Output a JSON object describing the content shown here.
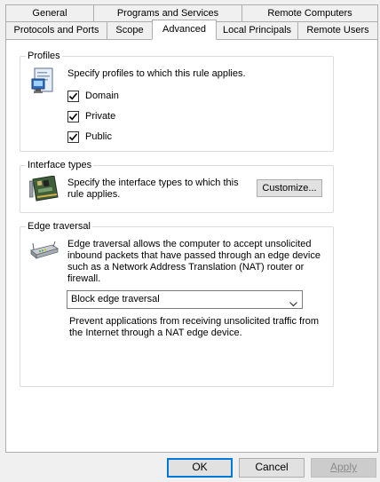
{
  "tabs": {
    "row1": [
      "General",
      "Programs and Services",
      "Remote Computers"
    ],
    "row2": [
      "Protocols and Ports",
      "Scope",
      "Advanced",
      "Local Principals",
      "Remote Users"
    ],
    "active": "Advanced"
  },
  "profiles": {
    "legend": "Profiles",
    "description": "Specify profiles to which this rule applies.",
    "items": [
      {
        "label": "Domain",
        "checked": true
      },
      {
        "label": "Private",
        "checked": true
      },
      {
        "label": "Public",
        "checked": true
      }
    ]
  },
  "interface_types": {
    "legend": "Interface types",
    "description_line1": "Specify the interface types to which this",
    "description_line2": "rule applies.",
    "customize_label": "Customize..."
  },
  "edge_traversal": {
    "legend": "Edge traversal",
    "description_lines": [
      "Edge traversal allows the computer to accept unsolicited",
      "inbound packets that have passed through an edge device",
      "such as a Network Address Translation (NAT) router or",
      "firewall."
    ],
    "selected_option": "Block edge traversal",
    "option_description_lines": [
      "Prevent applications from receiving unsolicited traffic from",
      "the Internet through a NAT edge device."
    ]
  },
  "footer": {
    "ok_label": "OK",
    "cancel_label": "Cancel",
    "apply_label": "Apply"
  },
  "icons": {
    "profiles": "computer-profile-icon",
    "interface": "network-card-icon",
    "edge": "router-icon",
    "checkbox": "checkmark-icon",
    "select": "chevron-down-icon"
  },
  "colors": {
    "dialog_bg": "#f0f0f0",
    "panel_bg": "#ffffff",
    "accent_border": "#0078d7",
    "disabled_text": "#8c8c8c"
  }
}
